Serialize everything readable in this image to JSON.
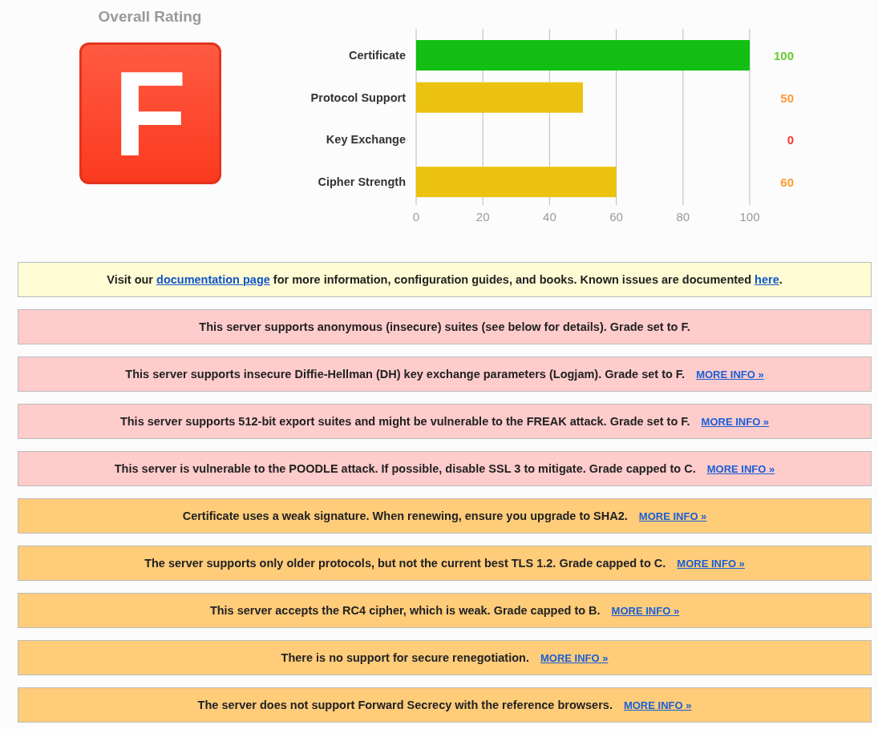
{
  "rating": {
    "title": "Overall Rating",
    "grade": "F"
  },
  "chart_data": {
    "type": "bar",
    "orientation": "horizontal",
    "categories": [
      "Certificate",
      "Protocol Support",
      "Key Exchange",
      "Cipher Strength"
    ],
    "values": [
      100,
      50,
      0,
      60
    ],
    "xlim": [
      0,
      100
    ],
    "xticks": [
      0,
      20,
      40,
      60,
      80,
      100
    ],
    "grid": true,
    "data_labels": true
  },
  "messages": [
    {
      "kind": "info",
      "parts": [
        {
          "text": "Visit our "
        },
        {
          "link": "documentation page"
        },
        {
          "text": " for more information, configuration guides, and books. Known issues are documented "
        },
        {
          "link": "here"
        },
        {
          "text": "."
        }
      ]
    },
    {
      "kind": "error",
      "parts": [
        {
          "text": "This server supports anonymous (insecure) suites (see below for details). Grade set to F."
        }
      ]
    },
    {
      "kind": "error",
      "parts": [
        {
          "text": "This server supports insecure Diffie-Hellman (DH) key exchange parameters (Logjam). Grade set to F."
        }
      ],
      "more": "MORE INFO »"
    },
    {
      "kind": "error",
      "parts": [
        {
          "text": "This server supports 512-bit export suites and might be vulnerable to the FREAK attack. Grade set to F."
        }
      ],
      "more": "MORE INFO »"
    },
    {
      "kind": "error",
      "parts": [
        {
          "text": "This server is vulnerable to the POODLE attack. If possible, disable SSL 3 to mitigate. Grade capped to C."
        }
      ],
      "more": "MORE INFO »"
    },
    {
      "kind": "warning",
      "parts": [
        {
          "text": "Certificate uses a weak signature. When renewing, ensure you upgrade to SHA2."
        }
      ],
      "more": "MORE INFO »"
    },
    {
      "kind": "warning",
      "parts": [
        {
          "text": "The server supports only older protocols, but not the current best TLS 1.2. Grade capped to C."
        }
      ],
      "more": "MORE INFO »"
    },
    {
      "kind": "warning",
      "parts": [
        {
          "text": "This server accepts the RC4 cipher, which is weak. Grade capped to B."
        }
      ],
      "more": "MORE INFO »"
    },
    {
      "kind": "warning",
      "parts": [
        {
          "text": "There is no support for secure renegotiation."
        }
      ],
      "more": "MORE INFO »"
    },
    {
      "kind": "warning",
      "parts": [
        {
          "text": "The server does not support Forward Secrecy with the reference browsers."
        }
      ],
      "more": "MORE INFO »"
    }
  ]
}
